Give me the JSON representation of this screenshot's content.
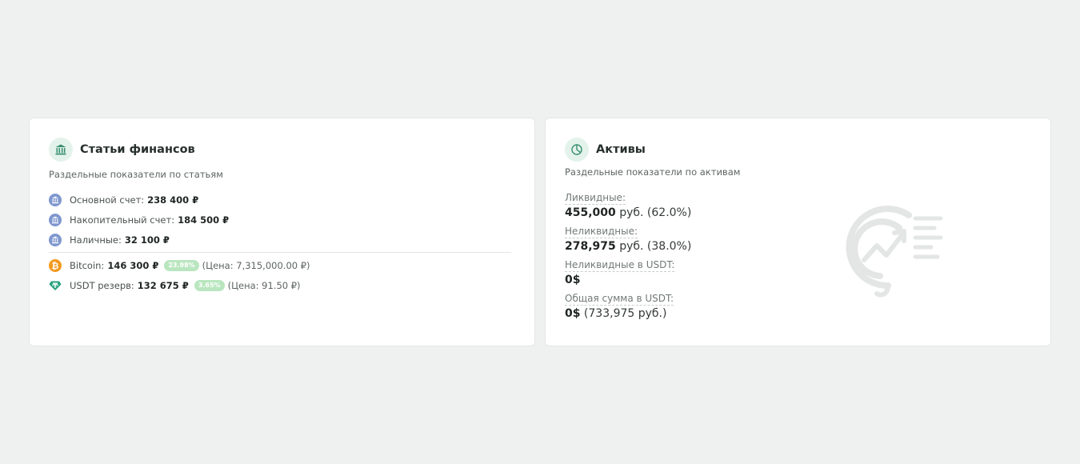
{
  "finance": {
    "title": "Статьи финансов",
    "subtitle": "Раздельные показатели по статьям",
    "icon": "bank-icon",
    "accounts": [
      {
        "label": "Основной счет:",
        "value": "238 400 ₽",
        "icon": "bank-icon"
      },
      {
        "label": "Накопительный счет:",
        "value": "184 500 ₽",
        "icon": "bank-icon"
      },
      {
        "label": "Наличные:",
        "value": "32 100 ₽",
        "icon": "bank-icon"
      }
    ],
    "crypto": [
      {
        "label": "Bitcoin:",
        "value": "146 300 ₽",
        "percent": "23.98%",
        "price": "(Цена: 7,315,000.00 ₽)",
        "icon": "bitcoin-icon"
      },
      {
        "label": "USDT резерв:",
        "value": "132 675 ₽",
        "percent": "3.65%",
        "price": "(Цена: 91.50 ₽)",
        "icon": "tether-icon"
      }
    ]
  },
  "assets": {
    "title": "Активы",
    "subtitle": "Раздельные показатели по активам",
    "icon": "pie-chart-icon",
    "items": [
      {
        "label": "Ликвидные:",
        "value": "455,000",
        "suffix": " руб. (62.0%)"
      },
      {
        "label": "Неликвидные:",
        "value": "278,975",
        "suffix": " руб. (38.0%)"
      },
      {
        "label": "Неликвидные в USDT:",
        "value": "0$",
        "suffix": ""
      },
      {
        "label": "Общая сумма в USDT:",
        "value": "0$",
        "suffix": " (733,975 руб.)"
      }
    ]
  },
  "colors": {
    "accent_green": "#2e8b6a",
    "bank_icon": "#7f97cf",
    "bitcoin": "#f39a1e",
    "tether": "#26a17b",
    "badge": "#b9e6bf"
  }
}
